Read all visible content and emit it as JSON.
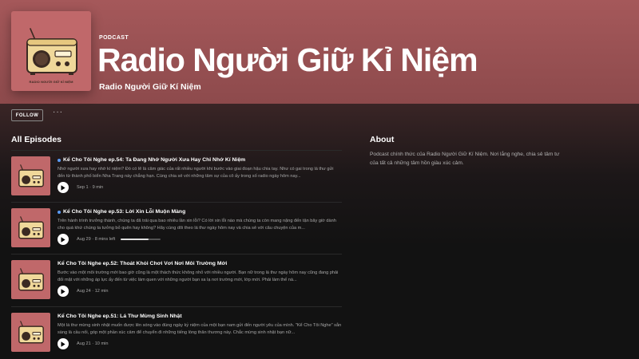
{
  "header": {
    "kind_label": "PODCAST",
    "title": "Radio Người Giữ Kỉ Niệm",
    "publisher": "Radio Người Giữ Kí Niệm",
    "cover_caption": "RADIO NGƯỜI GIỮ KỈ NIỆM"
  },
  "actions": {
    "follow_label": "FOLLOW",
    "more_label": "···"
  },
  "episodes_section": {
    "title": "All Episodes",
    "items": [
      {
        "is_new": true,
        "title": "Kể Cho Tôi Nghe ep.54: Ta Đang Nhớ Người Xưa Hay Chỉ Nhớ Kí Niệm",
        "description": "Nhớ người xưa hay nhớ kí niệm? Đó có lẽ là câm giác của rất nhiều người khi bước vào giai đoạn hậu chia tay. Như có gai trong lá thư gửi đến từ thành phố biển Nha Trang này chẳng hạn. Cùng chia sẻ với những tâm sự của cô ấy trong số radio ngày hôm nay...",
        "meta": "Sep 1 · 9 min",
        "progress": null
      },
      {
        "is_new": true,
        "title": "Kể Cho Tôi Nghe ep.53: Lời Xin Lỗi Muộn Màng",
        "description": "Trên hành trình trưởng thành, chúng ta đã trải qua bao nhiêu lần xin lỗi? Có lời xin lỗi nào mà chúng ta còn mang nặng đến tận bây giờ dành cho quá khứ chúng ta tưởng bỏ quên hay không? Hãy cùng dõi theo lá thư ngày hôm nay và chia sẻ với câu chuyện của m...",
        "meta": "Aug 29 · 8 mins left",
        "progress": 0.7
      },
      {
        "is_new": false,
        "title": "Kể Cho Tôi Nghe ep.52: Thoát Khỏi Chơi Vơi Nơi Môi Trường Mới",
        "description": "Bước vào một môi trường mới bao giờ cũng là một thách thức không nhỏ với nhiều người. Bạn nữ trong lá thư ngày hôm nay cũng đang phải đối mặt với những áp lực ấy đến từ việc làm quen với những người bạn xa lạ nơi trường mới, lớp mới. Phải làm thế nà...",
        "meta": "Aug 24 · 12 min",
        "progress": null
      },
      {
        "is_new": false,
        "title": "Kể Cho Tôi Nghe ep.51: Lá Thư Mừng Sinh Nhật",
        "description": "Một lá thư mừng sinh nhật muốn được lên sóng vào đúng ngày kỷ niệm của một bạn nam gửi đến người yêu của mình. \"Kể Cho Tôi Nghe\" sẵn sàng là cầu nối, góp một phần xúc cảm để chuyển đi những tiếng lòng thân thương này. Chắc mừng sinh nhật bạn nữ...",
        "meta": "Aug 21 · 10 min",
        "progress": null
      }
    ]
  },
  "about": {
    "title": "About",
    "text": "Podcast chính thức của Radio Người Giữ Kí Niệm. Nơi lắng nghe, chia sẻ tâm tư của tất cả những tâm hồn giàu xúc cảm."
  },
  "colors": {
    "header_bg": "#a5585a",
    "cover_bg": "#c0686a",
    "new_dot": "#5a9bf6",
    "page_bg": "#121212"
  }
}
